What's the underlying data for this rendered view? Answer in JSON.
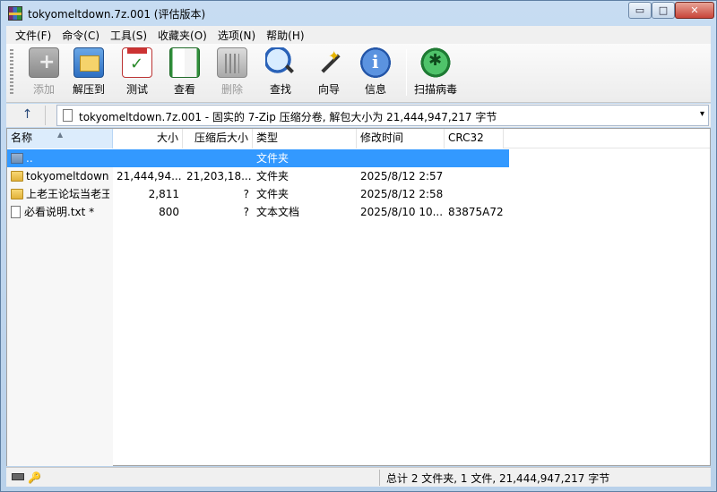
{
  "window": {
    "title": "tokyomeltdown.7z.001 (评估版本)",
    "controls": {
      "minimize": "▭",
      "maximize": "□",
      "close": "✕"
    }
  },
  "menu": [
    "文件(F)",
    "命令(C)",
    "工具(S)",
    "收藏夹(O)",
    "选项(N)",
    "帮助(H)"
  ],
  "toolbar": {
    "add": "添加",
    "extract": "解压到",
    "test": "测试",
    "view": "查看",
    "delete": "删除",
    "find": "查找",
    "wizard": "向导",
    "info": "信息",
    "virus_scan": "扫描病毒"
  },
  "address": {
    "up_icon": "↑",
    "text": "tokyomeltdown.7z.001 - 固实的 7-Zip 压缩分卷, 解包大小为 21,444,947,217 字节",
    "dropdown_icon": "▾"
  },
  "columns": {
    "name": "名称",
    "size": "大小",
    "packed": "压缩后大小",
    "type": "类型",
    "mtime": "修改时间",
    "crc": "CRC32"
  },
  "rows": [
    {
      "name": "..",
      "size": "",
      "packed": "",
      "type": "文件夹",
      "mtime": "",
      "crc": "",
      "icon": "up-folder"
    },
    {
      "name": "tokyomeltdown",
      "size": "21,444,94...",
      "packed": "21,203,18...",
      "type": "文件夹",
      "mtime": "2025/8/12 2:57",
      "crc": "",
      "icon": "folder"
    },
    {
      "name": "上老王论坛当老王",
      "size": "2,811",
      "packed": "?",
      "type": "文件夹",
      "mtime": "2025/8/12 2:58",
      "crc": "",
      "icon": "folder"
    },
    {
      "name": "必看说明.txt *",
      "size": "800",
      "packed": "?",
      "type": "文本文档",
      "mtime": "2025/8/10 10...",
      "crc": "83875A72",
      "icon": "text-file"
    }
  ],
  "status": {
    "summary": "总计 2 文件夹, 1 文件, 21,444,947,217 字节",
    "key_icon": "🔑"
  },
  "colors": {
    "selection": "#3399ff",
    "header_sorted": "#dcecfc",
    "frame": "#b9d1ea"
  }
}
